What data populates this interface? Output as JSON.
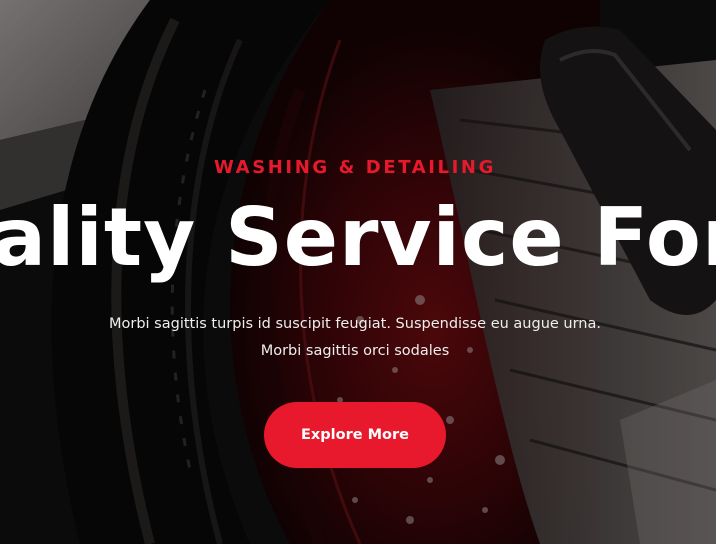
{
  "colors": {
    "accent": "#e8192c",
    "headline_text": "#ffffff",
    "body_text": "#eeeeee"
  },
  "hero": {
    "background_image": "car-wheel-brush-washing-photo",
    "eyebrow": "WASHING & DETAILING",
    "headline": "ality Service For Yo",
    "description": "Morbi sagittis turpis id suscipit feugiat. Suspendisse eu augue urna. Morbi sagittis orci sodales",
    "cta_label": "Explore More"
  }
}
